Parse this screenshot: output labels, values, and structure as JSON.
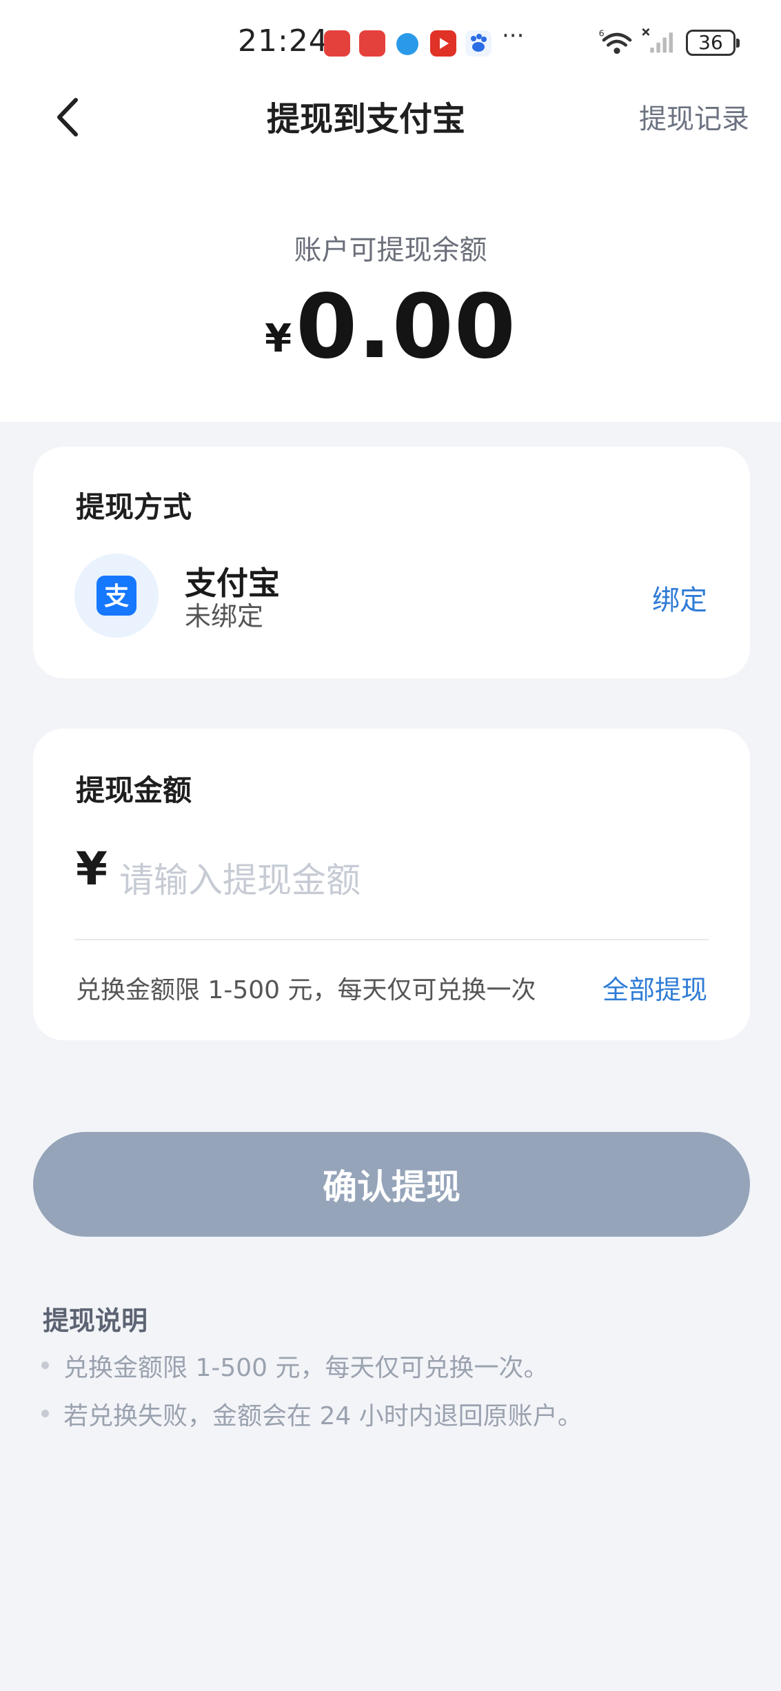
{
  "status_bar": {
    "time": "21:24",
    "battery": "36",
    "more_indicator": "···",
    "app_icons": [
      "huawei-app-icon",
      "huawei-app-icon",
      "app-icon-blue",
      "video-app-icon",
      "baidu-app-icon"
    ],
    "network_label": "6"
  },
  "nav": {
    "title": "提现到支付宝",
    "right_link": "提现记录"
  },
  "balance": {
    "label": "账户可提现余额",
    "currency": "¥",
    "amount": "0.00"
  },
  "method_card": {
    "title": "提现方式",
    "name": "支付宝",
    "status": "未绑定",
    "bind_label": "绑定",
    "logo_glyph": "支"
  },
  "amount_card": {
    "title": "提现金额",
    "currency": "¥",
    "placeholder": "请输入提现金额",
    "limit_text": "兑换金额限 1-500 元，每天仅可兑换一次",
    "all_label": "全部提现"
  },
  "confirm_label": "确认提现",
  "notes": {
    "title": "提现说明",
    "items": [
      "兑换金额限 1-500 元，每天仅可兑换一次。",
      "若兑换失败，金额会在 24 小时内退回原账户。"
    ]
  },
  "colors": {
    "accent": "#2f7cd6",
    "alipay": "#1677ff",
    "button_disabled": "#95a4b9",
    "background": "#f3f4f8"
  }
}
